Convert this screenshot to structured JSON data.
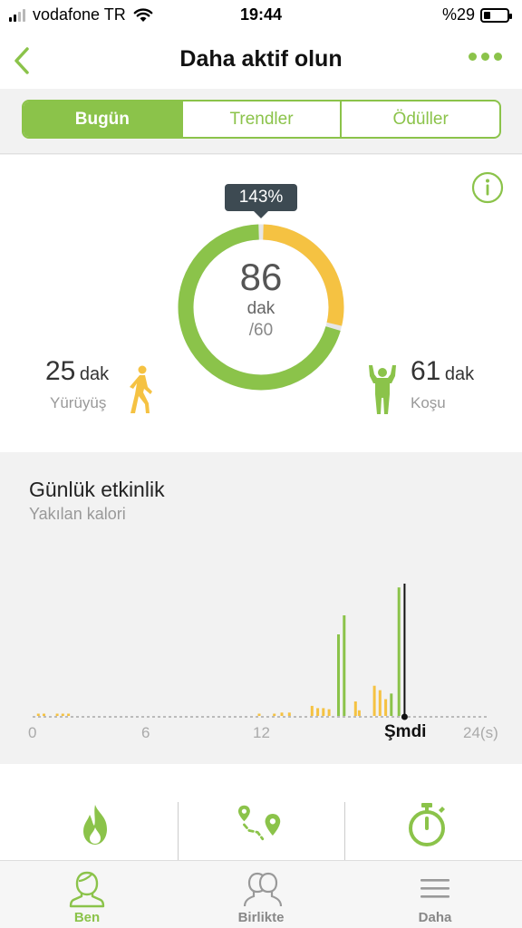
{
  "status_bar": {
    "carrier": "vodafone TR",
    "time": "19:44",
    "battery": "%29"
  },
  "nav": {
    "title": "Daha aktif olun"
  },
  "tabs_segment": [
    {
      "label": "Bugün",
      "active": true
    },
    {
      "label": "Trendler",
      "active": false
    },
    {
      "label": "Ödüller",
      "active": false
    }
  ],
  "ring": {
    "percent_label": "143%",
    "total_value": "86",
    "unit": "dak",
    "goal": "/60",
    "run_fraction": 0.709,
    "walk_fraction": 0.291,
    "colors": {
      "run": "#8bc34a",
      "walk": "#f5c242"
    }
  },
  "walk": {
    "value": "25",
    "unit": "dak",
    "label": "Yürüyüş",
    "icon": "walking-person-icon"
  },
  "run": {
    "value": "61",
    "unit": "dak",
    "label": "Koşu",
    "icon": "flexing-person-icon"
  },
  "activity": {
    "title": "Günlük etkinlik",
    "subtitle": "Yakılan kalori",
    "axis_labels": [
      "0",
      "6",
      "12",
      "Şmdi",
      "24(s)"
    ],
    "now_hour": 19.7
  },
  "chart_data": {
    "type": "bar",
    "title": "Günlük etkinlik",
    "subtitle": "Yakılan kalori",
    "xlabel": "",
    "ylabel": "",
    "xlim": [
      0,
      24
    ],
    "x_ticks": [
      "0",
      "6",
      "12",
      "Şmdi",
      "24(s)"
    ],
    "series": [
      {
        "name": "walk",
        "color": "#f5c242",
        "x": [
          0.3,
          0.6,
          1.3,
          1.6,
          1.9,
          12.0,
          12.8,
          13.2,
          13.6,
          14.8,
          15.1,
          15.4,
          15.7,
          17.1,
          17.3,
          18.1,
          18.4,
          18.7
        ],
        "values": [
          2,
          2,
          2,
          2,
          2,
          2,
          2,
          3,
          3,
          9,
          7,
          7,
          6,
          13,
          5,
          27,
          23,
          15
        ]
      },
      {
        "name": "run",
        "color": "#8bc34a",
        "x": [
          16.2,
          16.5,
          19.0,
          19.4
        ],
        "values": [
          73,
          90,
          20,
          115
        ]
      }
    ],
    "y_max": 120
  },
  "bottom_icons": [
    {
      "icon": "flame-icon"
    },
    {
      "icon": "route-icon"
    },
    {
      "icon": "stopwatch-icon"
    }
  ],
  "tab_bar": [
    {
      "label": "Ben",
      "icon": "person-icon",
      "active": true
    },
    {
      "label": "Birlikte",
      "icon": "people-icon",
      "active": false
    },
    {
      "label": "Daha",
      "icon": "menu-icon",
      "active": false
    }
  ]
}
